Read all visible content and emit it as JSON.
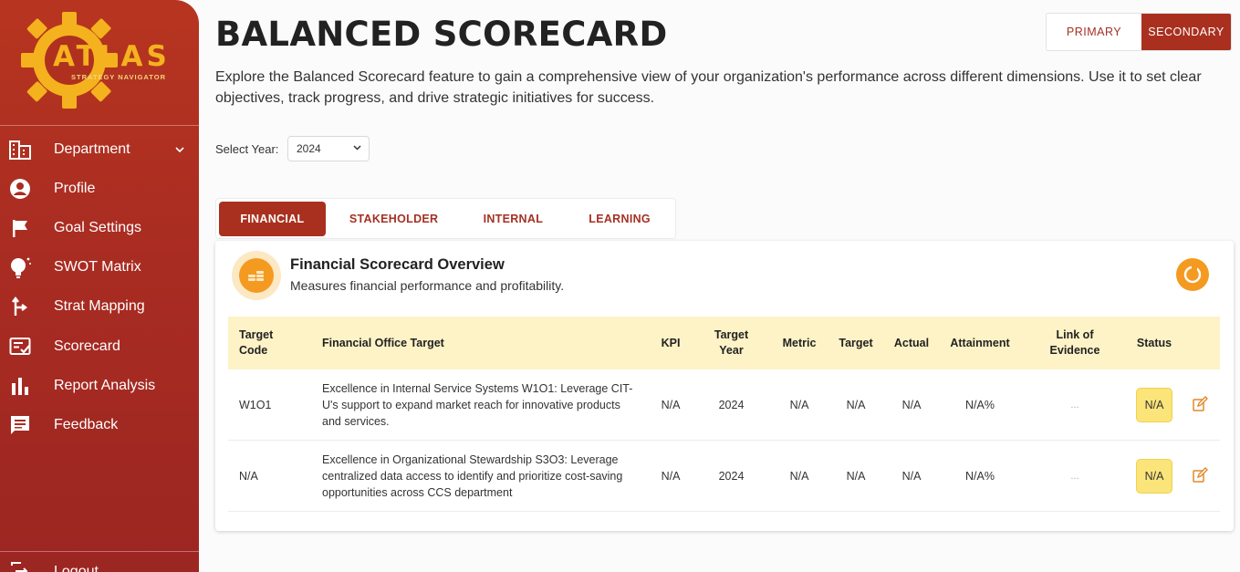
{
  "brand": {
    "name": "ATLAS",
    "tagline": "STRATEGY NAVIGATOR",
    "accent": "#a9301f",
    "gold": "#f4b21e"
  },
  "sidebar": {
    "items": [
      {
        "label": "Department",
        "icon": "building-icon",
        "has_dropdown": true
      },
      {
        "label": "Profile",
        "icon": "user-circle-icon"
      },
      {
        "label": "Goal Settings",
        "icon": "flag-icon"
      },
      {
        "label": "SWOT Matrix",
        "icon": "lightbulb-icon"
      },
      {
        "label": "Strat Mapping",
        "icon": "split-arrow-icon"
      },
      {
        "label": "Scorecard",
        "icon": "checklist-icon"
      },
      {
        "label": "Report Analysis",
        "icon": "bar-chart-icon"
      },
      {
        "label": "Feedback",
        "icon": "feedback-icon"
      }
    ],
    "logout_label": "Logout"
  },
  "header": {
    "title": "BALANCED SCORECARD",
    "description": "Explore the Balanced Scorecard feature to gain a comprehensive view of your organization's performance across different dimensions. Use it to set clear objectives, track progress, and drive strategic initiatives for success.",
    "primary_label": "PRIMARY",
    "secondary_label": "SECONDARY"
  },
  "year_filter": {
    "label": "Select Year:",
    "value": "2024"
  },
  "tabs": [
    {
      "label": "FINANCIAL",
      "active": true
    },
    {
      "label": "STAKEHOLDER"
    },
    {
      "label": "INTERNAL"
    },
    {
      "label": "LEARNING"
    }
  ],
  "card": {
    "title": "Financial Scorecard Overview",
    "subtitle": "Measures financial performance and profitability."
  },
  "table": {
    "headers": {
      "target_code": "Target Code",
      "office_target": "Financial Office Target",
      "kpi": "KPI",
      "target_year": "Target Year",
      "metric": "Metric",
      "target": "Target",
      "actual": "Actual",
      "attainment": "Attainment",
      "evidence": "Link of Evidence",
      "status": "Status"
    },
    "rows": [
      {
        "target_code": "W1O1",
        "office_target": "Excellence in Internal Service Systems W1O1: Leverage CIT-U's support to expand market reach for innovative products and services.",
        "kpi": "N/A",
        "target_year": "2024",
        "metric": "N/A",
        "target": "N/A",
        "actual": "N/A",
        "attainment": "N/A%",
        "evidence": "...",
        "status": "N/A"
      },
      {
        "target_code": "N/A",
        "office_target": "Excellence in Organizational Stewardship S3O3: Leverage centralized data access to identify and prioritize cost-saving opportunities across CCS department",
        "kpi": "N/A",
        "target_year": "2024",
        "metric": "N/A",
        "target": "N/A",
        "actual": "N/A",
        "attainment": "N/A%",
        "evidence": "...",
        "status": "N/A"
      }
    ]
  }
}
